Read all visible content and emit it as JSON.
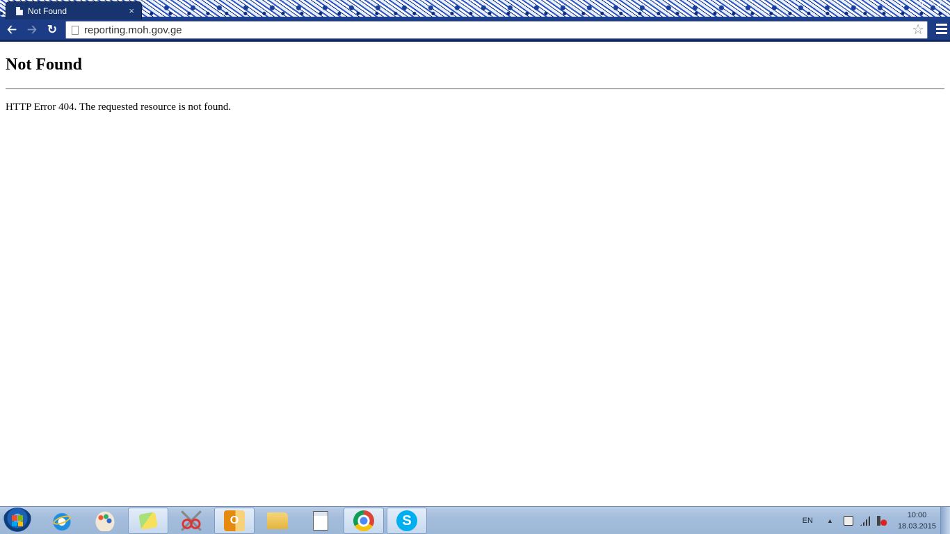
{
  "browser": {
    "tab_title": "Not Found",
    "tab_close": "×",
    "address": "reporting.moh.gov.ge",
    "icons": {
      "back": "arrow-left",
      "forward": "arrow-right",
      "reload": "reload",
      "bookmark": "star-outline",
      "menu": "hamburger"
    }
  },
  "page": {
    "heading": "Not Found",
    "message": "HTTP Error 404. The requested resource is not found."
  },
  "taskbar": {
    "apps": [
      "start-orb",
      "internet-explorer",
      "paint",
      "sticky-notes",
      "snipping-tool",
      "outlook",
      "windows-explorer",
      "notepad-document",
      "chrome",
      "skype"
    ],
    "active_apps": [
      "sticky-notes",
      "outlook",
      "chrome",
      "skype"
    ],
    "tray": {
      "language": "EN",
      "time": "10:00",
      "date": "18.03.2015"
    }
  },
  "colors": {
    "toolbar": "#1c3d86",
    "tab": "#17346f",
    "taskbar": "#a4bddc"
  }
}
